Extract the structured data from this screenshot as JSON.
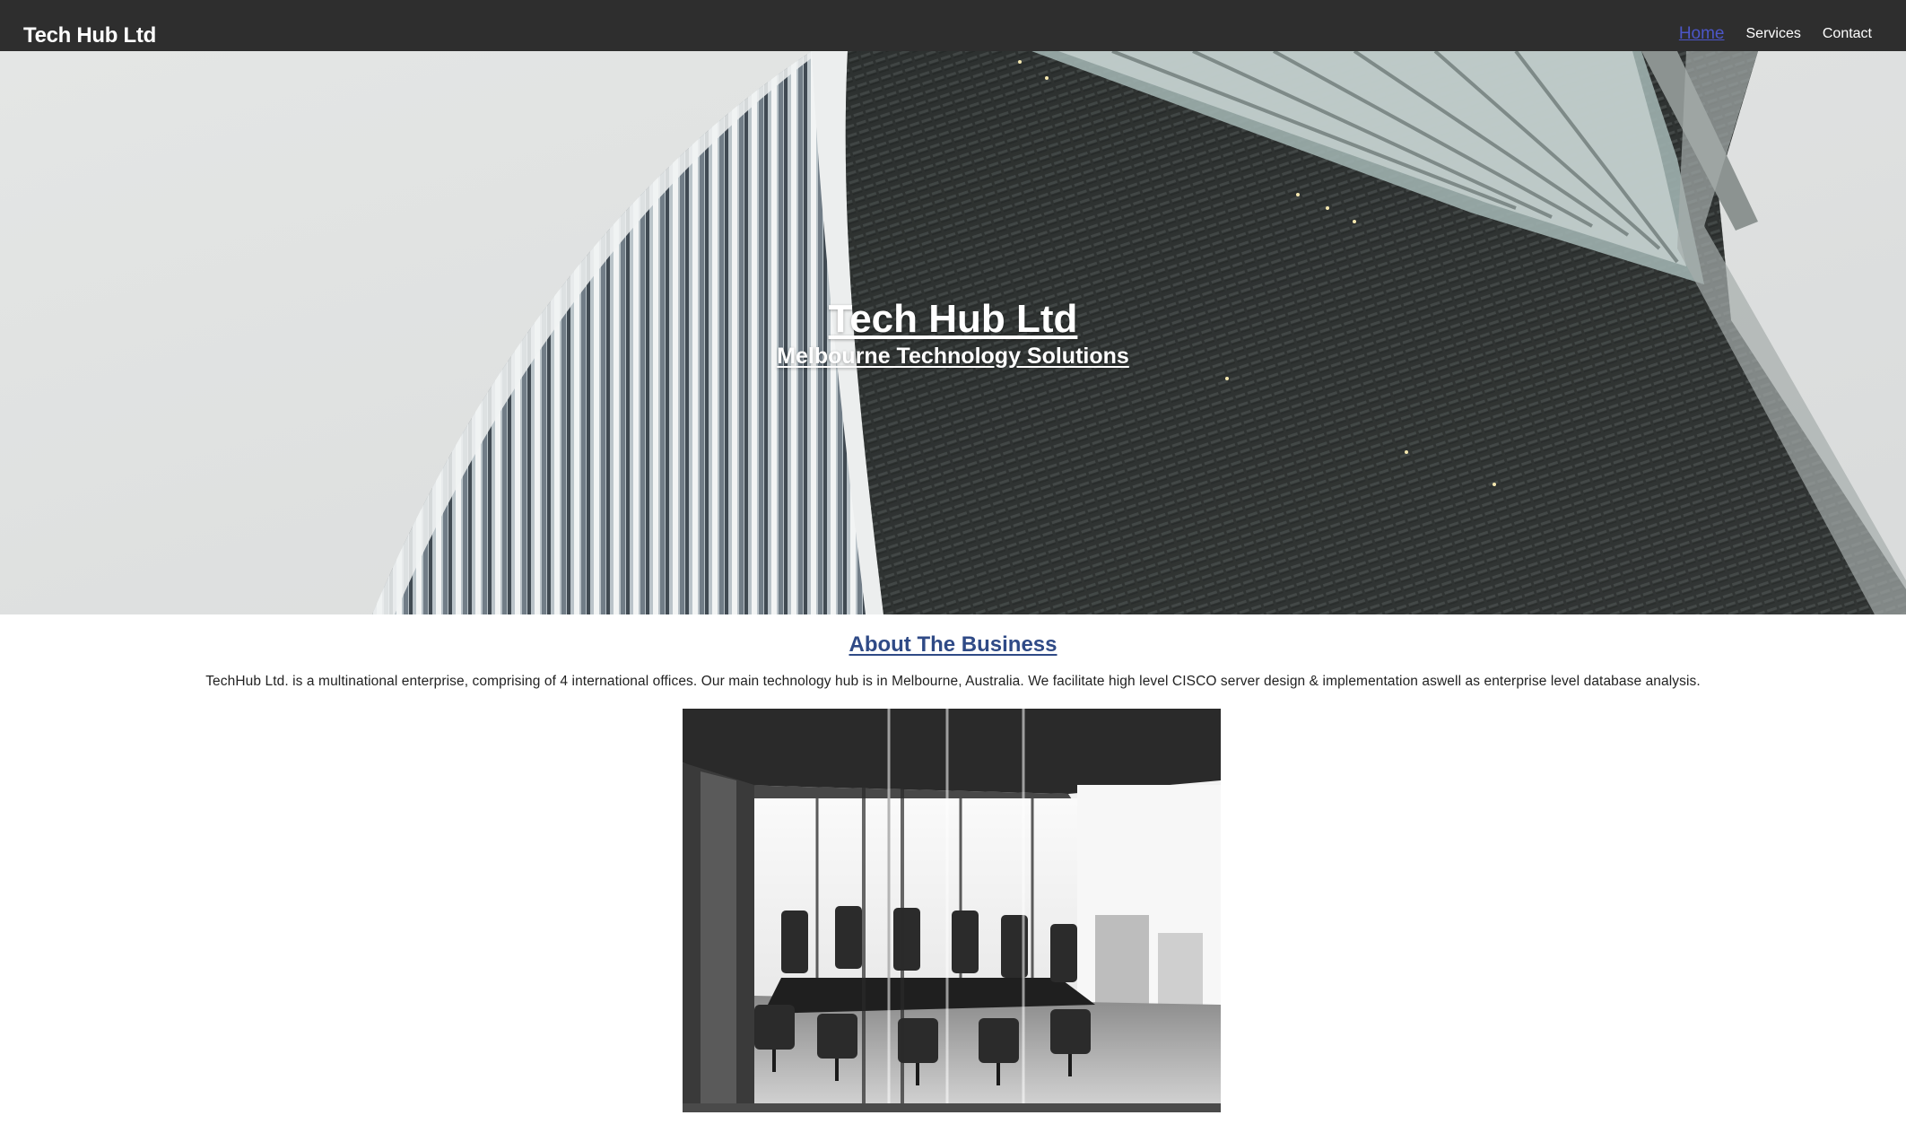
{
  "navbar": {
    "brand": "Tech Hub Ltd",
    "links": [
      {
        "label": "Home",
        "active": true
      },
      {
        "label": "Services",
        "active": false
      },
      {
        "label": "Contact",
        "active": false
      }
    ]
  },
  "hero": {
    "title": "Tech Hub Ltd",
    "subtitle": "Melbourne Technology Solutions",
    "image": "curved-office-building-photo"
  },
  "about": {
    "title": "About The Business",
    "text": "TechHub Ltd. is a multinational enterprise, comprising of 4 international offices. Our main technology hub is in Melbourne, Australia. We facilitate high level CISCO server design & implementation aswell as enterprise level database analysis.",
    "image": "glass-conference-room-photo"
  },
  "colors": {
    "navbar_bg": "#2e2e2e",
    "active_link": "#4c56c8",
    "about_title": "#2f4a86"
  }
}
